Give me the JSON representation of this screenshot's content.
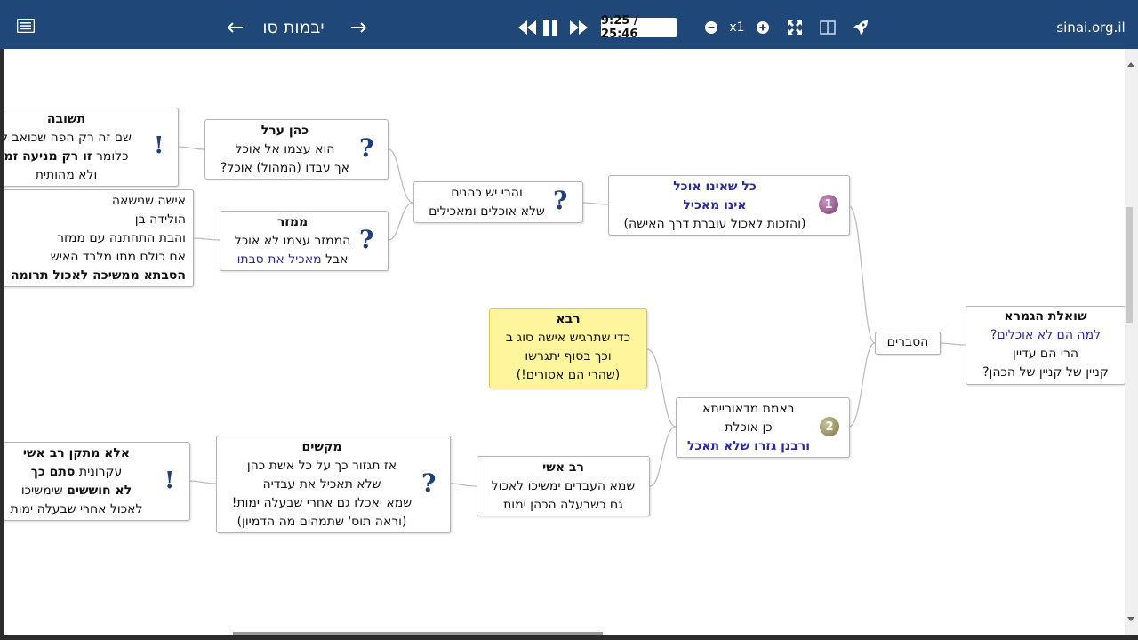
{
  "toolbar": {
    "title": "יבמות סו",
    "time": "9:25 / 25:46",
    "speed": "x1",
    "site": "sinai.org.il"
  },
  "nodes": {
    "root": {
      "l1": "שואלת הגמרא",
      "l2": "למה הם לא אוכלים?",
      "l3": "הרי הם עדיין",
      "l4": "קניין של קניין של הכהן?"
    },
    "hesberim": {
      "l1": "הסברים"
    },
    "n1": {
      "badge": "1",
      "l1": "כל שאינו אוכל",
      "l2": "אינו מאכיל",
      "l3": "(והזכות לאכול עוברת דרך האישה)"
    },
    "veharei": {
      "l1": "והרי יש כהנים",
      "l2": "שלא אוכלים ומאכילים"
    },
    "kohen_arel": {
      "l1": "כהן ערל",
      "l2": "הוא עצמו אל אוכל",
      "l3": "אך עבדו (המהול) אוכל?"
    },
    "mamzer": {
      "l1": "ממזר",
      "l2": "הממזר עצמו לא אוכל",
      "l3a": "אבל ",
      "l3b": "מאכיל את סבתו"
    },
    "teshuva": {
      "l1": "תשובה",
      "l2": "שם זה רק הפה שכואב ל",
      "l3a": "כלומר ",
      "l3b": "זו רק מניעה זמ",
      "l4": "ולא מהותית"
    },
    "isha": {
      "l1": "אישה שנישאה",
      "l2": "הולידה בן",
      "l3": "והבת התחתנה עם ממזר",
      "l4": "אם כולם מתו מלבד האיש",
      "l5": "הסבתא ממשיכה לאכול תרומה"
    },
    "n2": {
      "badge": "2",
      "l1": "באמת מדאורייתא",
      "l2": "כן אוכלת",
      "l3": "ורבנן גזרו שלא תאכל"
    },
    "rava": {
      "l1": "רבא",
      "l2": "כדי שתרגיש אישה סוג ב",
      "l3": "וכך בסוף יתגרשו",
      "l4": "(שהרי הם אסורים!)"
    },
    "rav_ashi": {
      "l1": "רב אשי",
      "l2": "שמא העבדים ימשיכו לאכול",
      "l3": "גם כשבעלה הכהן ימות"
    },
    "makshim": {
      "l1": "מקשים",
      "l2": "אז תגזור כך על כל אשת כהן",
      "l3": "שלא תאכיל את עבדיה",
      "l4": "שמא יאכלו גם אחרי שבעלה ימות!",
      "l5": "(וראה תוס' שתמהים מה הדמיון)"
    },
    "ela": {
      "l1": "אלא מתקן רב אשי",
      "l2a": "עקרונית ",
      "l2b": "סתם כך",
      "l3a": "לא חוששים",
      "l3b": " שימשיכו",
      "l4": "לאכול אחרי שבעלה ימות"
    }
  }
}
